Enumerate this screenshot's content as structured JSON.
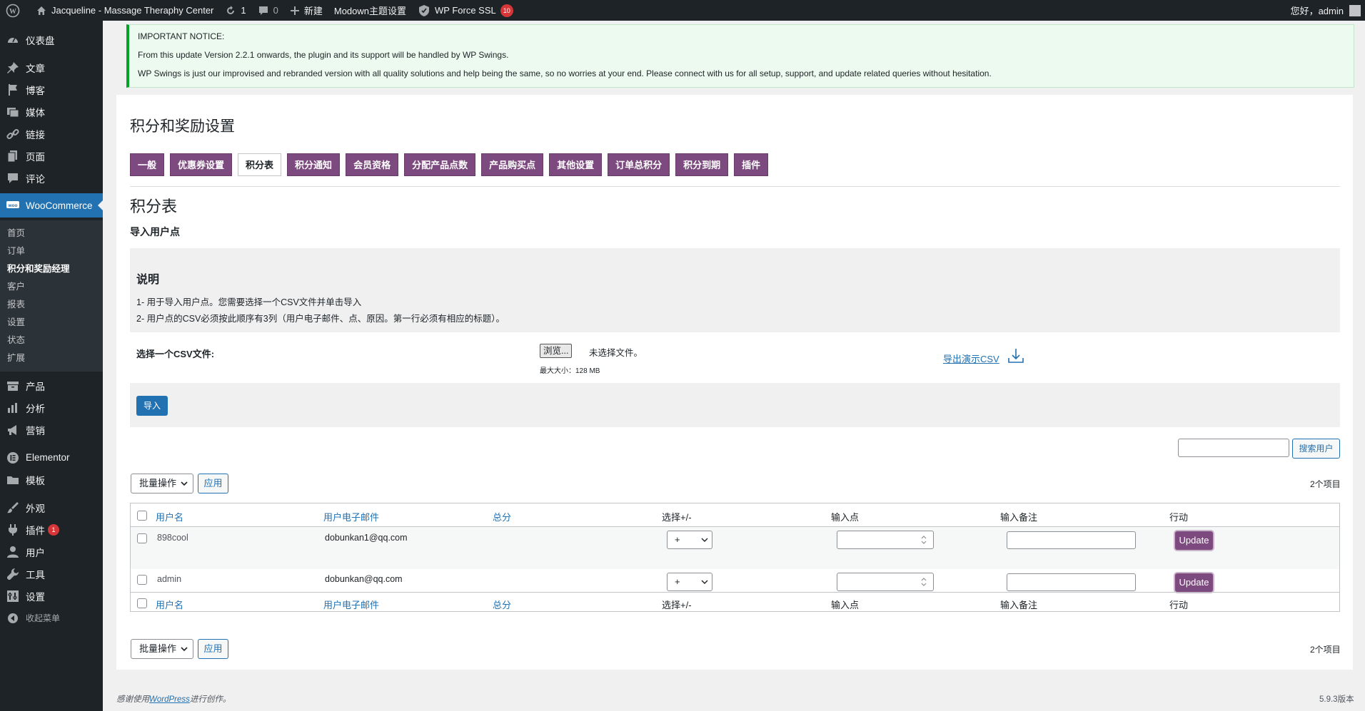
{
  "adminbar": {
    "site_name": "Jacqueline - Massage Theraphy Center",
    "updates_count": "1",
    "comments_count": "0",
    "new_label": "新建",
    "theme_settings": "Modown主题设置",
    "ssl_label": "WP Force SSL",
    "ssl_badge": "10",
    "greeting": "您好，admin"
  },
  "sidebar": {
    "dashboard": "仪表盘",
    "posts": "文章",
    "blog": "博客",
    "media": "媒体",
    "links": "链接",
    "pages": "页面",
    "comments": "评论",
    "woocommerce": "WooCommerce",
    "woo_sub": [
      "首页",
      "订单",
      "积分和奖励经理",
      "客户",
      "报表",
      "设置",
      "状态",
      "扩展"
    ],
    "products": "产品",
    "analytics": "分析",
    "marketing": "营销",
    "elementor": "Elementor",
    "templates": "模板",
    "appearance": "外观",
    "plugins": "插件",
    "plugins_badge": "1",
    "users": "用户",
    "tools": "工具",
    "settings": "设置",
    "collapse": "收起菜单"
  },
  "notice": {
    "heading": "IMPORTANT NOTICE:",
    "line1": "From this update Version 2.2.1 onwards, the plugin and its support will be handled by WP Swings.",
    "line2": "WP Swings is just our improvised and rebranded version with all quality solutions and help being the same, so no worries at your end. Please connect with us for all setup, support, and update related queries without hesitation."
  },
  "page": {
    "title": "积分和奖励设置",
    "tabs": [
      "一般",
      "优惠券设置",
      "积分表",
      "积分通知",
      "会员资格",
      "分配产品点数",
      "产品购买点",
      "其他设置",
      "订单总积分",
      "积分到期",
      "插件"
    ],
    "active_tab": "积分表",
    "section_title": "积分表",
    "import_title": "导入用户点",
    "desc_title": "说明",
    "desc_1": "1- 用于导入用户点。您需要选择一个CSV文件并单击导入",
    "desc_2": "2- 用户点的CSV必须按此顺序有3列（用户电子邮件、点、原因。第一行必须有相应的标题）。",
    "csv_label": "选择一个CSV文件:",
    "browse_label": "浏览...",
    "no_file": "未选择文件。",
    "max_size": "最大大小：128 MB",
    "export_link": "导出演示CSV",
    "import_button": "导入",
    "search_button": "搜索用户",
    "search_value": "",
    "bulk_action": "批量操作",
    "apply": "应用",
    "item_count": "2个项目"
  },
  "table": {
    "headers": [
      "用户名",
      "用户电子邮件",
      "总分",
      "选择+/-",
      "输入点",
      "输入备注",
      "行动"
    ],
    "rows": [
      {
        "username": "898cool",
        "email": "dobunkan1@qq.com",
        "total": "",
        "select": "+",
        "points": "",
        "note": "",
        "action": "Update"
      },
      {
        "username": "admin",
        "email": "dobunkan@qq.com",
        "total": "",
        "select": "+",
        "points": "",
        "note": "",
        "action": "Update"
      }
    ]
  },
  "footer": {
    "thanks_prefix": "感谢使用",
    "wordpress": "WordPress",
    "thanks_suffix": "进行创作。",
    "version": "5.9.3版本"
  },
  "colors": {
    "accent": "#2271b1",
    "plugin_purple": "#7d4a7f",
    "admin_dark": "#1d2327",
    "notice_green": "#00a32a"
  }
}
